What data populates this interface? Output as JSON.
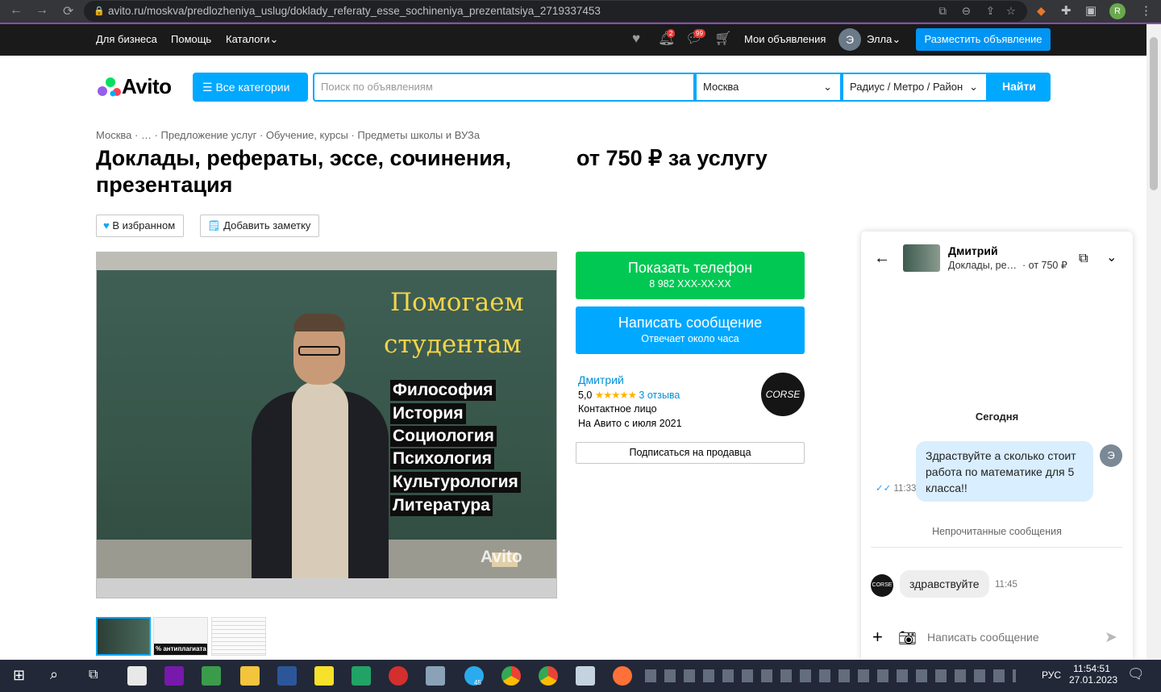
{
  "browser": {
    "url": "avito.ru/moskva/predlozheniya_uslug/doklady_referaty_esse_sochineniya_prezentatsiya_2719337453"
  },
  "topbar": {
    "for_business": "Для бизнеса",
    "help": "Помощь",
    "catalogs": "Каталоги",
    "notifications_badge": "2",
    "messages_badge": "99",
    "my_ads": "Мои объявления",
    "user_initial": "Э",
    "user_name": "Элла",
    "post_ad": "Разместить объявление"
  },
  "header": {
    "logo_text": "Avito",
    "all_categories": "Все категории",
    "search_placeholder": "Поиск по объявлениям",
    "city": "Москва",
    "radius": "Радиус / Метро / Район",
    "find": "Найти"
  },
  "breadcrumbs": [
    "Москва",
    "…",
    "Предложение услуг",
    "Обучение, курсы",
    "Предметы школы и ВУЗа"
  ],
  "listing": {
    "title": "Доклады, рефераты, эссе, сочинения, презентация",
    "price": "от 750 ₽ за услугу",
    "favorite": "В избранном",
    "add_note": "Добавить заметку",
    "photo": {
      "headline_1": "Помогаем",
      "headline_2": "студентам",
      "subjects": [
        "Философия",
        "История",
        "Социология",
        "Психология",
        "Культурология",
        "Литература"
      ],
      "watermark": "Avito"
    },
    "thumbnail_caption": "% антиплагиата"
  },
  "seller": {
    "show_phone": "Показать телефон",
    "phone_masked": "8 982 XXX-XX-XX",
    "write_message": "Написать сообщение",
    "response_time": "Отвечает около часа",
    "name": "Дмитрий",
    "rating": "5,0",
    "stars": "★★★★★",
    "reviews": "3 отзыва",
    "contact_type": "Контактное лицо",
    "since": "На Авито с июля 2021",
    "logo_text": "CORSE",
    "subscribe": "Подписаться на продавца"
  },
  "chat": {
    "name": "Дмитрий",
    "ad_title": "Доклады, ре…",
    "price": "· от 750 ₽",
    "day_label": "Сегодня",
    "outgoing_text": "Здраствуйте  а сколько стоит работа по математике для 5 класса!!",
    "outgoing_time": "11:33",
    "my_initial": "Э",
    "unread_label": "Непрочитанные сообщения",
    "incoming_text": "здравствуйте",
    "incoming_time": "11:45",
    "input_placeholder": "Написать сообщение"
  },
  "taskbar": {
    "language": "РУС",
    "time": "11:54:51",
    "date": "27.01.2023",
    "telegram_badge": "45"
  },
  "colors": {
    "accent_blue": "#00a8ff",
    "phone_green": "#00c853",
    "link_blue": "#0091d9",
    "topbar": "#1a1a1a"
  }
}
